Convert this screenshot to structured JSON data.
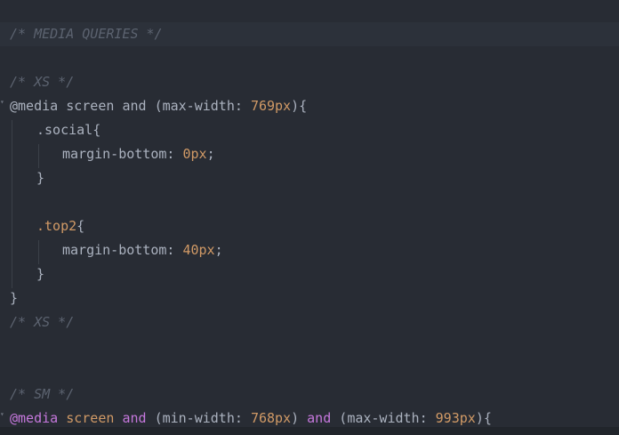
{
  "editor": {
    "lines": [
      {
        "id": "l1",
        "comment": "/* MEDIA QUERIES */"
      },
      {
        "id": "l2",
        "comment": "/* XS */"
      },
      {
        "id": "l3",
        "at": "@media",
        "screen": "screen",
        "and": "and",
        "paren_open": "(",
        "prop": "max-width",
        "colon": ": ",
        "value": "769px",
        "paren_close": ")",
        "brace": "{"
      },
      {
        "id": "l4",
        "selector": ".social",
        "brace": "{"
      },
      {
        "id": "l5",
        "prop": "margin-bottom",
        "colon": ": ",
        "value": "0px",
        "semi": ";"
      },
      {
        "id": "l6",
        "brace": "}"
      },
      {
        "id": "l7",
        "selector_dot": ".",
        "selector": "top2",
        "brace": "{"
      },
      {
        "id": "l8",
        "prop": "margin-bottom",
        "colon": ": ",
        "value": "40px",
        "semi": ";"
      },
      {
        "id": "l9",
        "brace": "}"
      },
      {
        "id": "l10",
        "brace": "}"
      },
      {
        "id": "l11",
        "comment": "/* XS */"
      },
      {
        "id": "l12",
        "comment": "/* SM */"
      },
      {
        "id": "l13",
        "at": "@media",
        "screen": "screen",
        "and": "and",
        "paren_open": "(",
        "prop": "min-width",
        "colon": ": ",
        "value": "768px",
        "paren_close": ")",
        "and2": "and",
        "paren_open2": "(",
        "prop2": "max-width",
        "colon2": ": ",
        "value2": "993px",
        "paren_close2": ")",
        "brace": "{"
      }
    ],
    "fold_marker": "▾"
  }
}
